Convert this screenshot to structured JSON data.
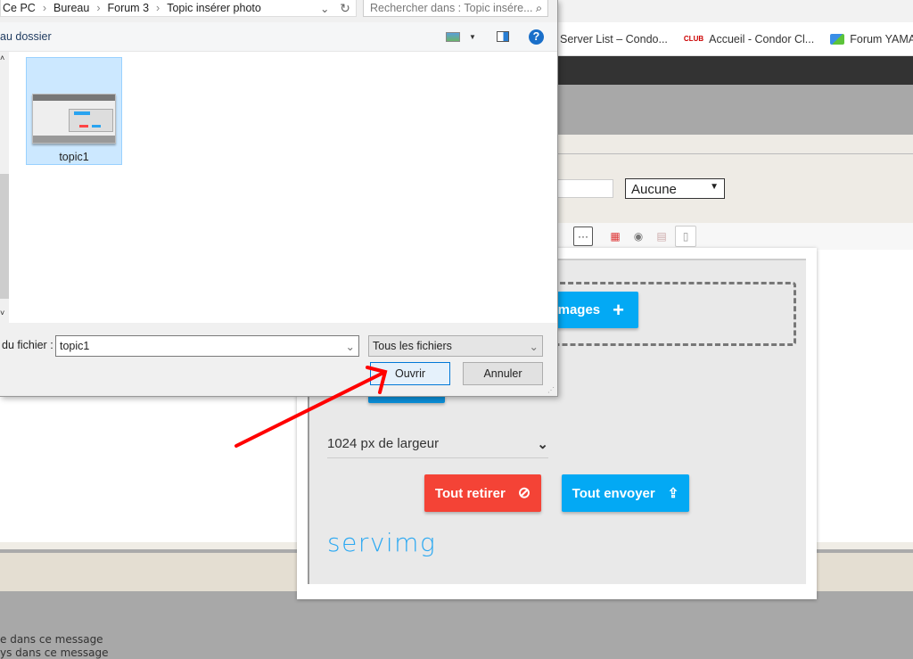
{
  "browser": {
    "bookmarks": [
      {
        "label": "Server List – Condo...",
        "icon": "none"
      },
      {
        "label": "Accueil - Condor Cl...",
        "icon": "condor-club-icon"
      },
      {
        "label": "Forum YAMAH",
        "icon": "chat-bubbles-icon"
      }
    ]
  },
  "page": {
    "select_value": "Aucune",
    "bottom_lines": [
      "e dans ce message",
      "ys dans ce message"
    ]
  },
  "upload_modal": {
    "add_images_label": "images",
    "size_select_value": "1024 px de largeur",
    "remove_all_label": "Tout retirer",
    "send_all_label": "Tout envoyer",
    "logo": "servimg",
    "colors": {
      "primary": "#03a9f4",
      "danger": "#f44336",
      "logo": "#2aa8f2"
    }
  },
  "file_dialog": {
    "breadcrumb": [
      "Ce PC",
      "Bureau",
      "Forum 3",
      "Topic insérer photo"
    ],
    "search_placeholder": "Rechercher dans : Topic insére...",
    "new_folder_label": "au dossier",
    "files": [
      {
        "name": "topic1",
        "selected": true
      }
    ],
    "filename_label": "du fichier :",
    "filename_value": "topic1",
    "filetype_value": "Tous les fichiers",
    "open_label": "Ouvrir",
    "cancel_label": "Annuler"
  },
  "annotation": {
    "arrow_color": "#ff0000"
  }
}
